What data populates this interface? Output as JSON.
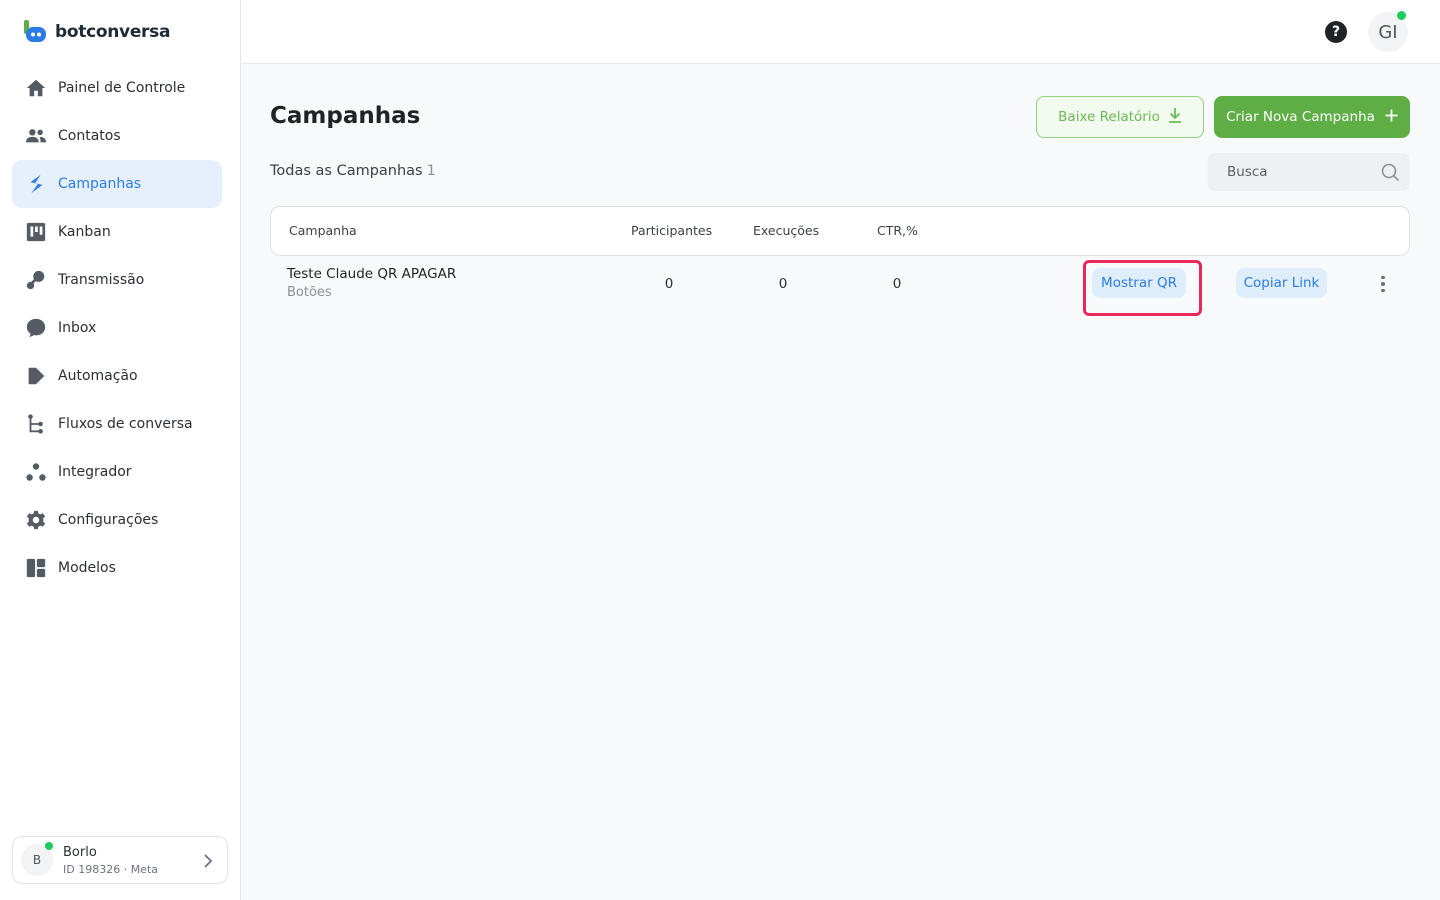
{
  "brand": {
    "name": "botconversa"
  },
  "sidebar": {
    "items": [
      {
        "label": "Painel de Controle",
        "icon": "home-icon"
      },
      {
        "label": "Contatos",
        "icon": "users-icon"
      },
      {
        "label": "Campanhas",
        "icon": "campaign-icon",
        "active": true
      },
      {
        "label": "Kanban",
        "icon": "kanban-icon"
      },
      {
        "label": "Transmissão",
        "icon": "broadcast-icon"
      },
      {
        "label": "Inbox",
        "icon": "chat-bubble-icon"
      },
      {
        "label": "Automação",
        "icon": "automation-icon"
      },
      {
        "label": "Fluxos de conversa",
        "icon": "flow-icon"
      },
      {
        "label": "Integrador",
        "icon": "integration-icon"
      },
      {
        "label": "Configurações",
        "icon": "gear-icon"
      },
      {
        "label": "Modelos",
        "icon": "templates-icon"
      }
    ]
  },
  "account": {
    "initial": "B",
    "name": "Borlo",
    "sub": "ID 198326 · Meta"
  },
  "topbar": {
    "help": "?",
    "user_initials": "GI"
  },
  "page": {
    "title": "Campanhas",
    "report_button": "Baixe Relatório",
    "new_button": "Criar Nova Campanha",
    "subtitle": "Todas as Campanhas",
    "count": "1",
    "search_placeholder": "Busca"
  },
  "table": {
    "headers": [
      "Campanha",
      "Participantes",
      "Execuções",
      "CTR,%"
    ],
    "rows": [
      {
        "name": "Teste Claude QR APAGAR",
        "type": "Botões",
        "participants": "0",
        "executions": "0",
        "ctr": "0",
        "qr_button": "Mostrar QR",
        "link_button": "Copiar Link"
      }
    ]
  },
  "colors": {
    "accent_blue": "#2c7be5",
    "accent_green": "#5fad45",
    "highlight_red": "#e8285b",
    "online_green": "#1fcb5b"
  }
}
